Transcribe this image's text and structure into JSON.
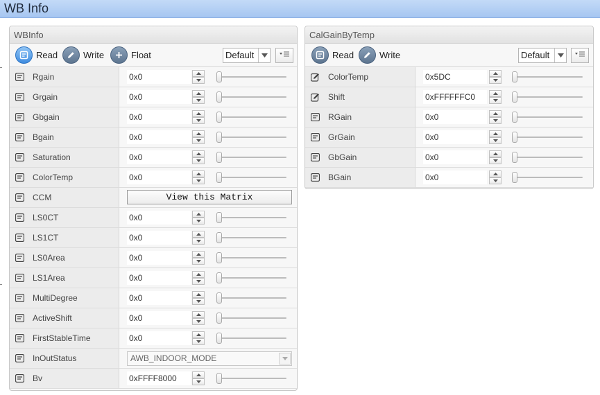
{
  "window": {
    "title": "WB Info"
  },
  "wbinfo": {
    "title": "WBInfo",
    "toolbar": {
      "read": "Read",
      "write": "Write",
      "float": "Float",
      "preset": "Default"
    },
    "rows": [
      {
        "label": "Rgain",
        "value": "0x0",
        "kind": "number"
      },
      {
        "label": "Grgain",
        "value": "0x0",
        "kind": "number"
      },
      {
        "label": "Gbgain",
        "value": "0x0",
        "kind": "number"
      },
      {
        "label": "Bgain",
        "value": "0x0",
        "kind": "number"
      },
      {
        "label": "Saturation",
        "value": "0x0",
        "kind": "number"
      },
      {
        "label": "ColorTemp",
        "value": "0x0",
        "kind": "number"
      },
      {
        "label": "CCM",
        "value": "View this Matrix",
        "kind": "button"
      },
      {
        "label": "LS0CT",
        "value": "0x0",
        "kind": "number"
      },
      {
        "label": "LS1CT",
        "value": "0x0",
        "kind": "number"
      },
      {
        "label": "LS0Area",
        "value": "0x0",
        "kind": "number"
      },
      {
        "label": "LS1Area",
        "value": "0x0",
        "kind": "number"
      },
      {
        "label": "MultiDegree",
        "value": "0x0",
        "kind": "number"
      },
      {
        "label": "ActiveShift",
        "value": "0x0",
        "kind": "number"
      },
      {
        "label": "FirstStableTime",
        "value": "0x0",
        "kind": "number"
      },
      {
        "label": "InOutStatus",
        "value": "AWB_INDOOR_MODE",
        "kind": "select"
      },
      {
        "label": "Bv",
        "value": "0xFFFF8000",
        "kind": "number"
      }
    ]
  },
  "calgain": {
    "title": "CalGainByTemp",
    "toolbar": {
      "read": "Read",
      "write": "Write",
      "preset": "Default"
    },
    "rows": [
      {
        "label": "ColorTemp",
        "value": "0x5DC",
        "icon": "edit-icon"
      },
      {
        "label": "Shift",
        "value": "0xFFFFFFC0",
        "icon": "edit-icon"
      },
      {
        "label": "RGain",
        "value": "0x0",
        "icon": "readonly-icon"
      },
      {
        "label": "GrGain",
        "value": "0x0",
        "icon": "readonly-icon"
      },
      {
        "label": "GbGain",
        "value": "0x0",
        "icon": "readonly-icon"
      },
      {
        "label": "BGain",
        "value": "0x0",
        "icon": "readonly-icon"
      }
    ]
  }
}
